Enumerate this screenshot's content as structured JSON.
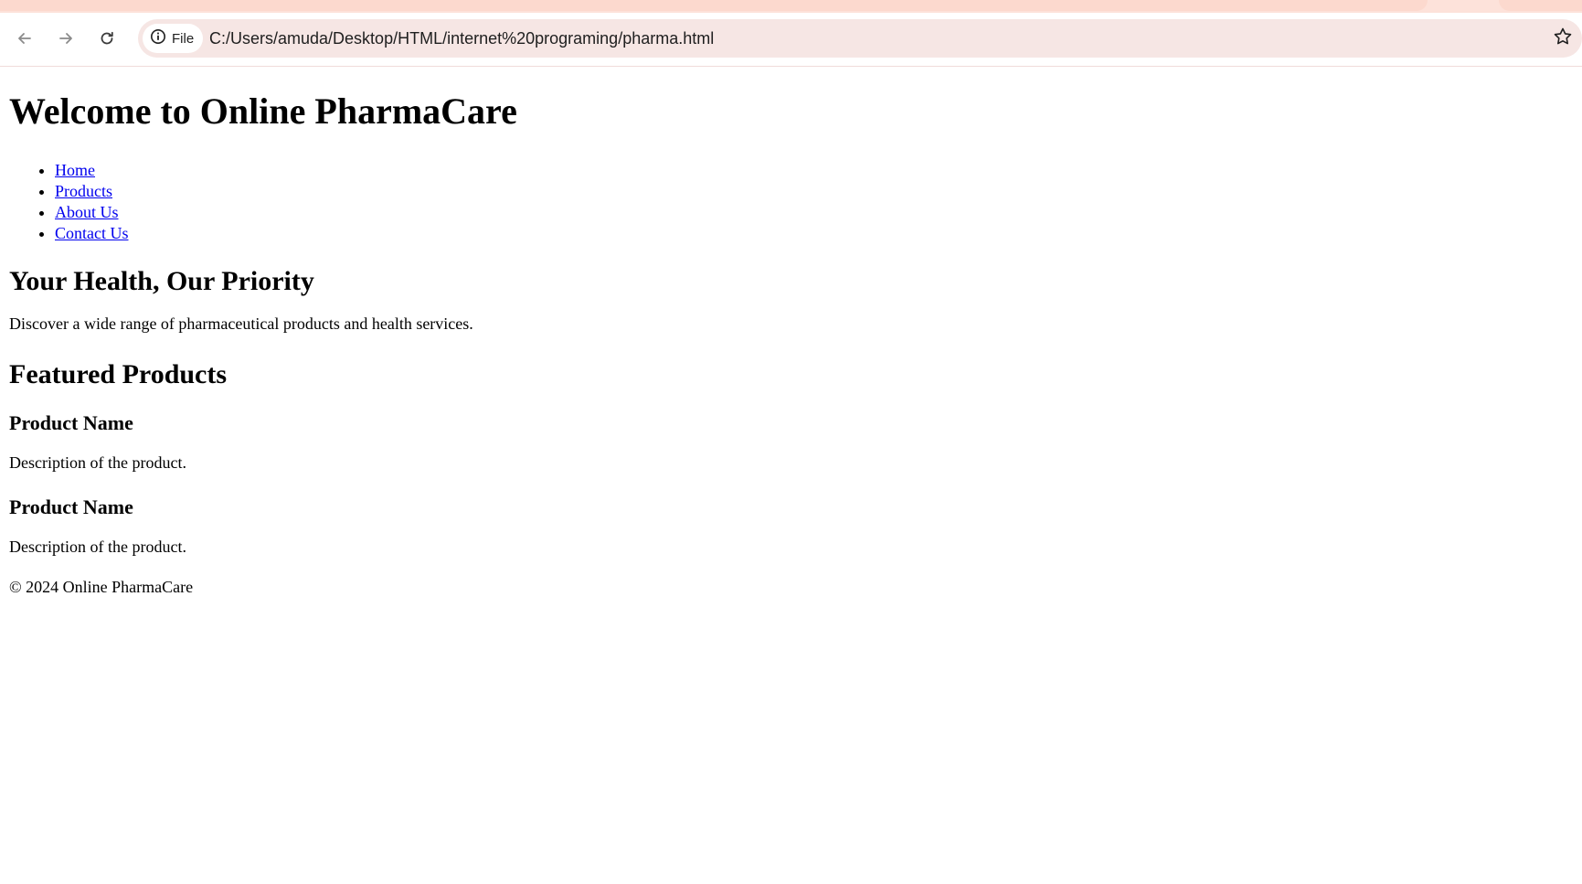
{
  "browser": {
    "site_chip_label": "File",
    "url": "C:/Users/amuda/Desktop/HTML/internet%20programing/pharma.html"
  },
  "page": {
    "title": "Welcome to Online PharmaCare",
    "nav": [
      {
        "label": "Home"
      },
      {
        "label": "Products"
      },
      {
        "label": "About Us"
      },
      {
        "label": "Contact Us"
      }
    ],
    "hero": {
      "heading": "Your Health, Our Priority",
      "text": "Discover a wide range of pharmaceutical products and health services."
    },
    "featured": {
      "heading": "Featured Products",
      "products": [
        {
          "name": "Product Name",
          "description": "Description of the product."
        },
        {
          "name": "Product Name",
          "description": "Description of the product."
        }
      ]
    },
    "footer": "© 2024 Online PharmaCare"
  },
  "colors": {
    "link": "#0000ee",
    "tabstrip": "#fcd9ce",
    "omnibox": "#f6e6e4"
  },
  "icons": [
    "back-arrow-icon",
    "forward-arrow-icon",
    "reload-icon",
    "info-icon",
    "star-icon"
  ]
}
